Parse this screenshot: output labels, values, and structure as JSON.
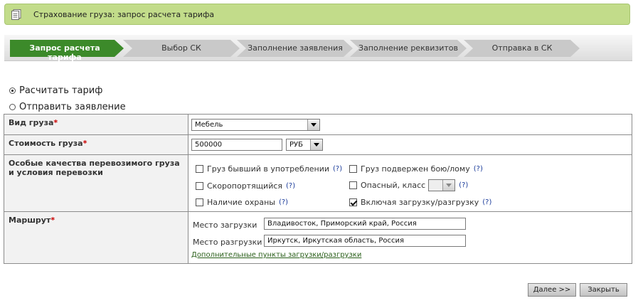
{
  "header": {
    "title": "Страхование груза: запрос расчета тарифа",
    "icon": "document-icon"
  },
  "steps": [
    {
      "label": "Запрос расчета тарифа",
      "active": true
    },
    {
      "label": "Выбор СК",
      "active": false
    },
    {
      "label": "Заполнение заявления",
      "active": false
    },
    {
      "label": "Заполнение реквизитов",
      "active": false
    },
    {
      "label": "Отправка в СК",
      "active": false
    }
  ],
  "mode": {
    "options": [
      {
        "label": "Расчитать тариф",
        "checked": true
      },
      {
        "label": "Отправить заявление",
        "checked": false
      }
    ]
  },
  "form": {
    "cargo_type": {
      "label": "Вид груза",
      "required_mark": "*",
      "value": "Мебель"
    },
    "cargo_cost": {
      "label": "Стоимость груза",
      "required_mark": "*",
      "value": "500000",
      "currency": "РУБ"
    },
    "special": {
      "label": "Особые качества перевозимого груза и условия перевозки",
      "options": [
        {
          "label": "Груз бывший в употреблении",
          "help": "(?)",
          "checked": false
        },
        {
          "label": "Груз подвержен бою/лому",
          "help": "(?)",
          "checked": false
        },
        {
          "label": "Скоропортящийся",
          "help": "(?)",
          "checked": false
        },
        {
          "label": "Опасный, класс",
          "help": "(?)",
          "checked": false
        },
        {
          "label": "Наличие охраны",
          "help": "(?)",
          "checked": false
        },
        {
          "label": "Включая загрузку/разгрузку",
          "help": "(?)",
          "checked": true
        }
      ],
      "hazard_class_value": ""
    },
    "route": {
      "label": "Маршрут",
      "required_mark": "*",
      "loading_label": "Место загрузки",
      "loading_value": "Владивосток, Приморский край, Россия",
      "unloading_label": "Место разгрузки",
      "unloading_value": "Иркутск, Иркутская область, Россия",
      "extra_link": "Дополнительные пункты загрузки/разгрузки"
    }
  },
  "buttons": {
    "next": "Далее >>",
    "close": "Закрыть"
  },
  "colors": {
    "header_bg": "#c2dc8a",
    "active_step": "#3c8a2a",
    "accent_link": "#2a5f1a",
    "required": "#cc0000"
  }
}
